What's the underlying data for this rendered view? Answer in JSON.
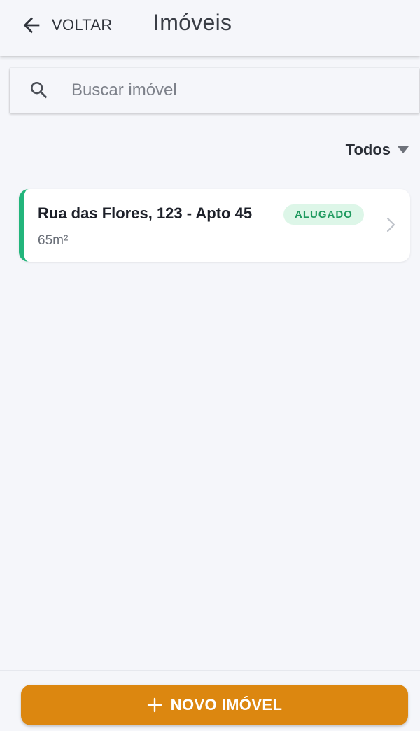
{
  "header": {
    "back_label": "VOLTAR",
    "title": "Imóveis",
    "back_icon": "arrow-left-icon"
  },
  "search": {
    "placeholder": "Buscar imóvel",
    "value": "",
    "icon": "search-icon"
  },
  "filter": {
    "selected": "Todos",
    "icon": "caret-down-icon"
  },
  "properties": [
    {
      "title": "Rua das Flores, 123 - Apto 45",
      "status": "ALUGADO",
      "area": "65m²",
      "accent_color": "#22b57b",
      "status_bg": "#ddf6e8",
      "status_color": "#1f9a5f"
    }
  ],
  "footer": {
    "new_button_label": "NOVO IMÓVEL",
    "new_button_icon": "plus-icon",
    "button_color": "#dc8710"
  }
}
